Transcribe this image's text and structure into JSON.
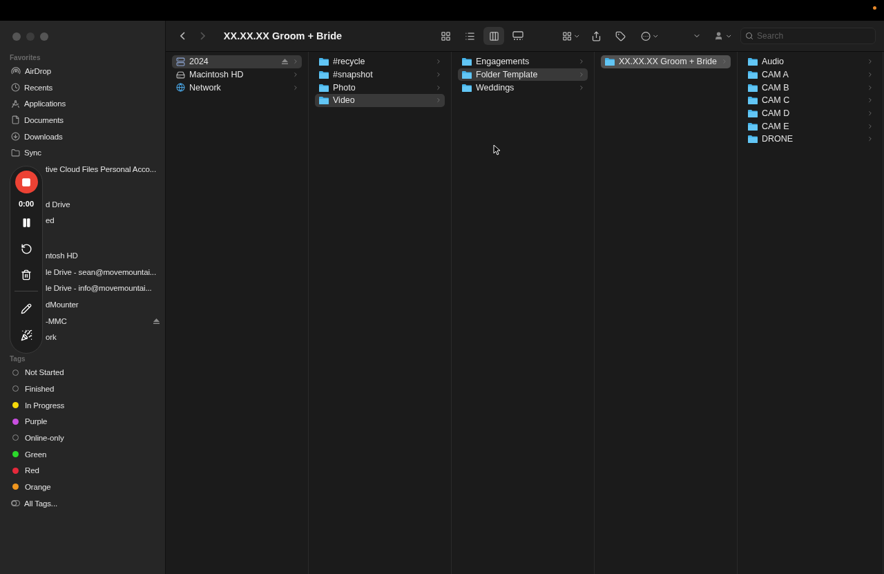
{
  "window": {
    "title": "XX.XX.XX Groom + Bride"
  },
  "toolbar": {
    "view_modes": [
      {
        "selected": false
      },
      {
        "selected": false
      },
      {
        "selected": true
      },
      {
        "selected": false
      }
    ],
    "search": {
      "placeholder": "Search"
    }
  },
  "recorder": {
    "time": "0:00"
  },
  "sidebar": {
    "sections": [
      {
        "title": "Favorites",
        "items": [
          {
            "label": "AirDrop",
            "covered": false,
            "ejectable": false
          },
          {
            "label": "Recents",
            "covered": false,
            "ejectable": false
          },
          {
            "label": "Applications",
            "covered": false,
            "ejectable": false
          },
          {
            "label": "Documents",
            "covered": false,
            "ejectable": false
          },
          {
            "label": "Downloads",
            "covered": false,
            "ejectable": false
          },
          {
            "label": "Sync",
            "covered": false,
            "ejectable": false
          },
          {
            "label": "tive Cloud Files Personal Acco...",
            "covered": true,
            "ejectable": false
          }
        ]
      },
      {
        "items": [
          {
            "label": "d Drive",
            "covered": true,
            "ejectable": false
          },
          {
            "label": "ed",
            "covered": true,
            "ejectable": false
          }
        ]
      },
      {
        "items": [
          {
            "label": "ntosh HD",
            "covered": true,
            "ejectable": false
          },
          {
            "label": "le Drive - sean@movemountai...",
            "covered": true,
            "ejectable": false
          },
          {
            "label": "le Drive - info@movemountai...",
            "covered": true,
            "ejectable": false
          },
          {
            "label": "dMounter",
            "covered": true,
            "ejectable": false
          },
          {
            "label": "-MMC",
            "covered": true,
            "ejectable": true
          },
          {
            "label": "ork",
            "covered": true,
            "ejectable": false
          }
        ]
      }
    ],
    "tags": {
      "title": "Tags",
      "items": [
        {
          "label": "Not Started",
          "kind": "ring"
        },
        {
          "label": "Finished",
          "kind": "ring"
        },
        {
          "label": "In Progress",
          "kind": "dot",
          "color": "#f5d90a"
        },
        {
          "label": "Purple",
          "kind": "dot",
          "color": "#c94fe0"
        },
        {
          "label": "Online-only",
          "kind": "ring"
        },
        {
          "label": "Green",
          "kind": "dot",
          "color": "#2bd92b"
        },
        {
          "label": "Red",
          "kind": "dot",
          "color": "#e5293b"
        },
        {
          "label": "Orange",
          "kind": "dot",
          "color": "#f0961e"
        },
        {
          "label": "All Tags...",
          "kind": "all"
        }
      ]
    }
  },
  "columns": [
    {
      "items": [
        {
          "label": "2024",
          "kind": "server",
          "selected": true,
          "ejectable": true
        },
        {
          "label": "Macintosh HD",
          "kind": "disk",
          "selected": false,
          "ejectable": false
        },
        {
          "label": "Network",
          "kind": "network",
          "selected": false,
          "ejectable": false
        }
      ]
    },
    {
      "items": [
        {
          "label": "#recycle",
          "kind": "folder",
          "selected": false,
          "ejectable": false
        },
        {
          "label": "#snapshot",
          "kind": "folder",
          "selected": false,
          "ejectable": false
        },
        {
          "label": "Photo",
          "kind": "folder",
          "selected": false,
          "ejectable": false
        },
        {
          "label": "Video",
          "kind": "folder",
          "selected": true,
          "ejectable": false
        }
      ]
    },
    {
      "items": [
        {
          "label": "Engagements",
          "kind": "folder",
          "selected": false,
          "ejectable": false
        },
        {
          "label": "Folder Template",
          "kind": "folder",
          "selected": true,
          "ejectable": false
        },
        {
          "label": "Weddings",
          "kind": "folder",
          "selected": false,
          "ejectable": false
        }
      ]
    },
    {
      "items": [
        {
          "label": "XX.XX.XX Groom + Bride",
          "kind": "folder",
          "selected": true,
          "ejectable": false
        }
      ]
    },
    {
      "items": [
        {
          "label": "Audio",
          "kind": "folder",
          "selected": false,
          "ejectable": false
        },
        {
          "label": "CAM A",
          "kind": "folder",
          "selected": false,
          "ejectable": false
        },
        {
          "label": "CAM B",
          "kind": "folder",
          "selected": false,
          "ejectable": false
        },
        {
          "label": "CAM C",
          "kind": "folder",
          "selected": false,
          "ejectable": false
        },
        {
          "label": "CAM D",
          "kind": "folder",
          "selected": false,
          "ejectable": false
        },
        {
          "label": "CAM E",
          "kind": "folder",
          "selected": false,
          "ejectable": false
        },
        {
          "label": "DRONE",
          "kind": "folder",
          "selected": false,
          "ejectable": false
        }
      ]
    }
  ]
}
